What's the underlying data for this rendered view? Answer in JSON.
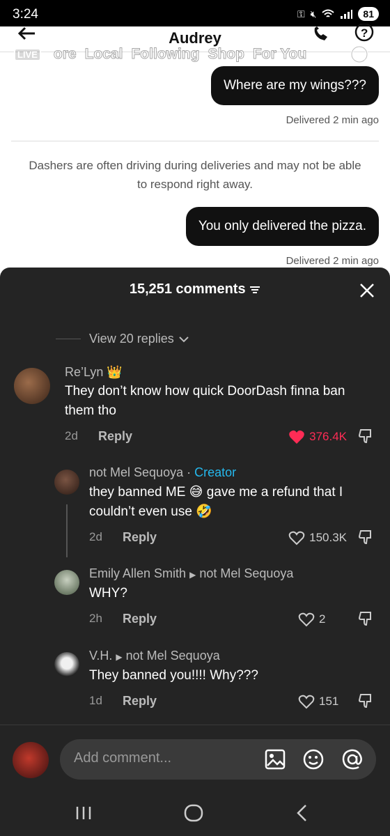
{
  "status_bar": {
    "time": "3:24",
    "battery": "81"
  },
  "chat": {
    "title": "Audrey",
    "messages": [
      {
        "text": "Where are my wings???",
        "status": "Delivered 2 min ago"
      },
      {
        "text": "You only delivered the pizza.",
        "status": "Delivered 2 min ago"
      }
    ],
    "notice_line1": "Dashers are often driving during deliveries and may not be able",
    "notice_line2": "to respond right away."
  },
  "overlay_tabs": {
    "live": "LIVE",
    "items": [
      "ore",
      "Local",
      "Following",
      "Shop",
      "For You"
    ]
  },
  "comments_panel": {
    "title": "15,251 comments",
    "view_replies": "View 20 replies",
    "comments": [
      {
        "name": "Re’Lyn",
        "text_line1": "They don’t know how quick DoorDash finna ban",
        "text_line2": "them tho",
        "age": "2d",
        "reply_label": "Reply",
        "likes": "376.4K"
      },
      {
        "name": "not Mel Sequoya",
        "creator_label": "Creator",
        "separator": "·",
        "text_line1_a": "they banned ME",
        "text_line1_b": "gave me a refund that I",
        "text_line2": "couldn’t even use",
        "age": "2d",
        "reply_label": "Reply",
        "likes": "150.3K"
      },
      {
        "name": "Emily Allen Smith",
        "reply_to": "not Mel Sequoya",
        "text": "WHY?",
        "age": "2h",
        "reply_label": "Reply",
        "likes": "2"
      },
      {
        "name": "V.H.",
        "reply_to": "not Mel Sequoya",
        "text": "They banned you!!!! Why???",
        "age": "1d",
        "reply_label": "Reply",
        "likes": "151"
      }
    ],
    "input_placeholder": "Add comment..."
  },
  "colors": {
    "accent_like": "#fe2c55",
    "creator": "#25b9ee",
    "panel_bg": "#242424"
  }
}
